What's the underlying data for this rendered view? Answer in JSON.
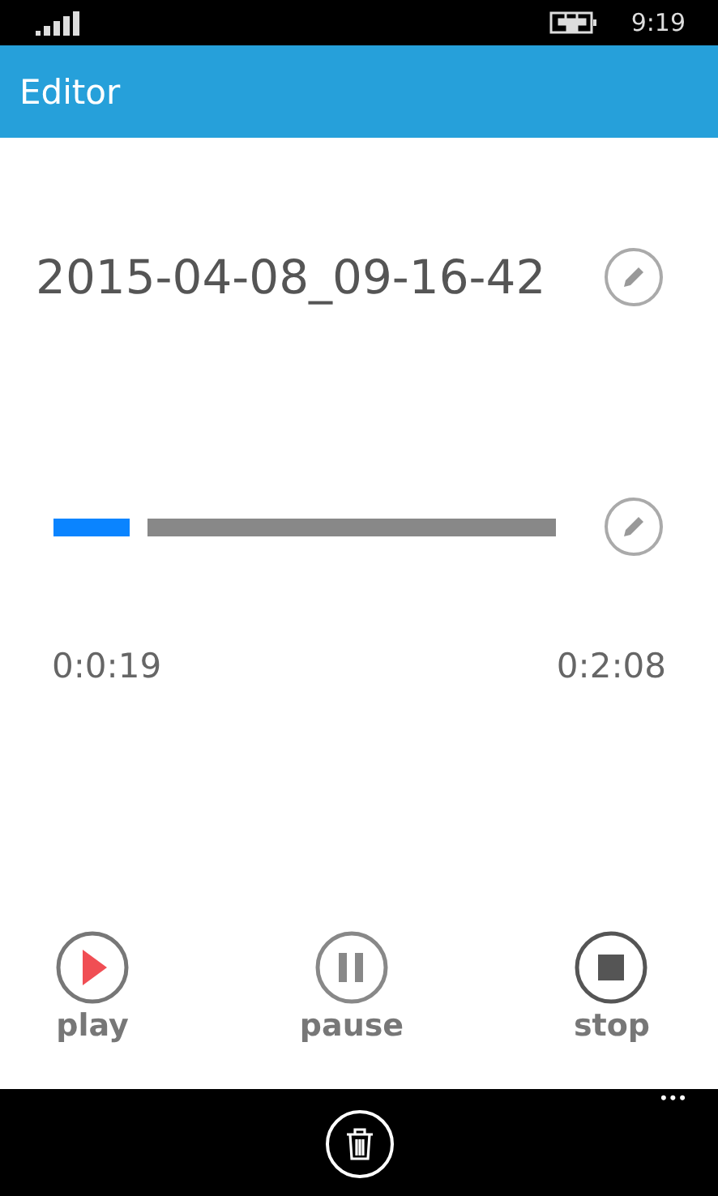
{
  "status_bar": {
    "time": "9:19"
  },
  "header": {
    "title": "Editor"
  },
  "recording": {
    "name": "2015-04-08_09-16-42"
  },
  "timeline": {
    "level": 0.15,
    "elapsed": "0:0:19",
    "total": "0:2:08"
  },
  "controls": [
    {
      "kind": "play",
      "label": "play"
    },
    {
      "kind": "pause",
      "label": "pause"
    },
    {
      "kind": "stop",
      "label": "stop"
    }
  ],
  "app_bar": {
    "more": "•••"
  }
}
